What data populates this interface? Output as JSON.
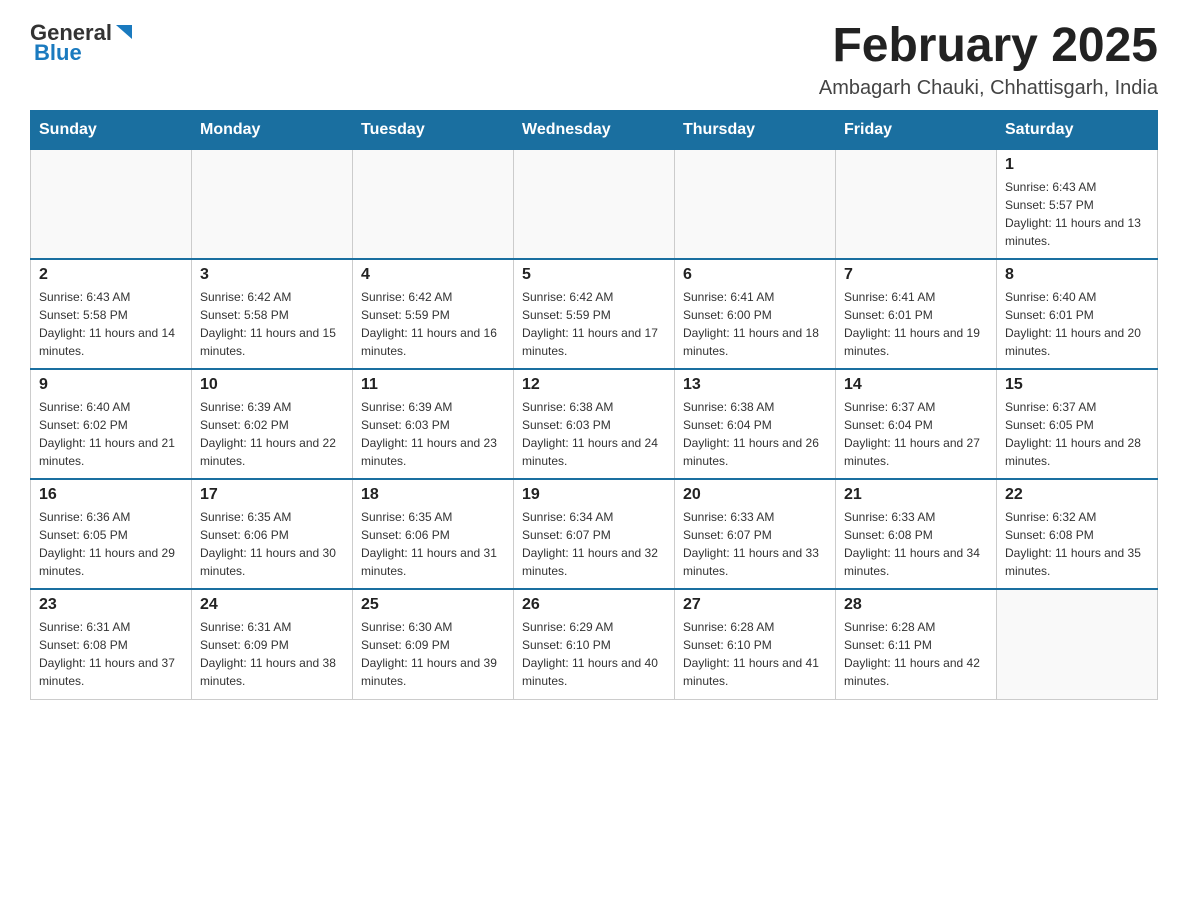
{
  "header": {
    "logo_general": "General",
    "logo_blue": "Blue",
    "month_year": "February 2025",
    "location": "Ambagarh Chauki, Chhattisgarh, India"
  },
  "weekdays": [
    "Sunday",
    "Monday",
    "Tuesday",
    "Wednesday",
    "Thursday",
    "Friday",
    "Saturday"
  ],
  "weeks": [
    [
      {
        "day": "",
        "sunrise": "",
        "sunset": "",
        "daylight": "",
        "empty": true
      },
      {
        "day": "",
        "sunrise": "",
        "sunset": "",
        "daylight": "",
        "empty": true
      },
      {
        "day": "",
        "sunrise": "",
        "sunset": "",
        "daylight": "",
        "empty": true
      },
      {
        "day": "",
        "sunrise": "",
        "sunset": "",
        "daylight": "",
        "empty": true
      },
      {
        "day": "",
        "sunrise": "",
        "sunset": "",
        "daylight": "",
        "empty": true
      },
      {
        "day": "",
        "sunrise": "",
        "sunset": "",
        "daylight": "",
        "empty": true
      },
      {
        "day": "1",
        "sunrise": "Sunrise: 6:43 AM",
        "sunset": "Sunset: 5:57 PM",
        "daylight": "Daylight: 11 hours and 13 minutes.",
        "empty": false
      }
    ],
    [
      {
        "day": "2",
        "sunrise": "Sunrise: 6:43 AM",
        "sunset": "Sunset: 5:58 PM",
        "daylight": "Daylight: 11 hours and 14 minutes.",
        "empty": false
      },
      {
        "day": "3",
        "sunrise": "Sunrise: 6:42 AM",
        "sunset": "Sunset: 5:58 PM",
        "daylight": "Daylight: 11 hours and 15 minutes.",
        "empty": false
      },
      {
        "day": "4",
        "sunrise": "Sunrise: 6:42 AM",
        "sunset": "Sunset: 5:59 PM",
        "daylight": "Daylight: 11 hours and 16 minutes.",
        "empty": false
      },
      {
        "day": "5",
        "sunrise": "Sunrise: 6:42 AM",
        "sunset": "Sunset: 5:59 PM",
        "daylight": "Daylight: 11 hours and 17 minutes.",
        "empty": false
      },
      {
        "day": "6",
        "sunrise": "Sunrise: 6:41 AM",
        "sunset": "Sunset: 6:00 PM",
        "daylight": "Daylight: 11 hours and 18 minutes.",
        "empty": false
      },
      {
        "day": "7",
        "sunrise": "Sunrise: 6:41 AM",
        "sunset": "Sunset: 6:01 PM",
        "daylight": "Daylight: 11 hours and 19 minutes.",
        "empty": false
      },
      {
        "day": "8",
        "sunrise": "Sunrise: 6:40 AM",
        "sunset": "Sunset: 6:01 PM",
        "daylight": "Daylight: 11 hours and 20 minutes.",
        "empty": false
      }
    ],
    [
      {
        "day": "9",
        "sunrise": "Sunrise: 6:40 AM",
        "sunset": "Sunset: 6:02 PM",
        "daylight": "Daylight: 11 hours and 21 minutes.",
        "empty": false
      },
      {
        "day": "10",
        "sunrise": "Sunrise: 6:39 AM",
        "sunset": "Sunset: 6:02 PM",
        "daylight": "Daylight: 11 hours and 22 minutes.",
        "empty": false
      },
      {
        "day": "11",
        "sunrise": "Sunrise: 6:39 AM",
        "sunset": "Sunset: 6:03 PM",
        "daylight": "Daylight: 11 hours and 23 minutes.",
        "empty": false
      },
      {
        "day": "12",
        "sunrise": "Sunrise: 6:38 AM",
        "sunset": "Sunset: 6:03 PM",
        "daylight": "Daylight: 11 hours and 24 minutes.",
        "empty": false
      },
      {
        "day": "13",
        "sunrise": "Sunrise: 6:38 AM",
        "sunset": "Sunset: 6:04 PM",
        "daylight": "Daylight: 11 hours and 26 minutes.",
        "empty": false
      },
      {
        "day": "14",
        "sunrise": "Sunrise: 6:37 AM",
        "sunset": "Sunset: 6:04 PM",
        "daylight": "Daylight: 11 hours and 27 minutes.",
        "empty": false
      },
      {
        "day": "15",
        "sunrise": "Sunrise: 6:37 AM",
        "sunset": "Sunset: 6:05 PM",
        "daylight": "Daylight: 11 hours and 28 minutes.",
        "empty": false
      }
    ],
    [
      {
        "day": "16",
        "sunrise": "Sunrise: 6:36 AM",
        "sunset": "Sunset: 6:05 PM",
        "daylight": "Daylight: 11 hours and 29 minutes.",
        "empty": false
      },
      {
        "day": "17",
        "sunrise": "Sunrise: 6:35 AM",
        "sunset": "Sunset: 6:06 PM",
        "daylight": "Daylight: 11 hours and 30 minutes.",
        "empty": false
      },
      {
        "day": "18",
        "sunrise": "Sunrise: 6:35 AM",
        "sunset": "Sunset: 6:06 PM",
        "daylight": "Daylight: 11 hours and 31 minutes.",
        "empty": false
      },
      {
        "day": "19",
        "sunrise": "Sunrise: 6:34 AM",
        "sunset": "Sunset: 6:07 PM",
        "daylight": "Daylight: 11 hours and 32 minutes.",
        "empty": false
      },
      {
        "day": "20",
        "sunrise": "Sunrise: 6:33 AM",
        "sunset": "Sunset: 6:07 PM",
        "daylight": "Daylight: 11 hours and 33 minutes.",
        "empty": false
      },
      {
        "day": "21",
        "sunrise": "Sunrise: 6:33 AM",
        "sunset": "Sunset: 6:08 PM",
        "daylight": "Daylight: 11 hours and 34 minutes.",
        "empty": false
      },
      {
        "day": "22",
        "sunrise": "Sunrise: 6:32 AM",
        "sunset": "Sunset: 6:08 PM",
        "daylight": "Daylight: 11 hours and 35 minutes.",
        "empty": false
      }
    ],
    [
      {
        "day": "23",
        "sunrise": "Sunrise: 6:31 AM",
        "sunset": "Sunset: 6:08 PM",
        "daylight": "Daylight: 11 hours and 37 minutes.",
        "empty": false
      },
      {
        "day": "24",
        "sunrise": "Sunrise: 6:31 AM",
        "sunset": "Sunset: 6:09 PM",
        "daylight": "Daylight: 11 hours and 38 minutes.",
        "empty": false
      },
      {
        "day": "25",
        "sunrise": "Sunrise: 6:30 AM",
        "sunset": "Sunset: 6:09 PM",
        "daylight": "Daylight: 11 hours and 39 minutes.",
        "empty": false
      },
      {
        "day": "26",
        "sunrise": "Sunrise: 6:29 AM",
        "sunset": "Sunset: 6:10 PM",
        "daylight": "Daylight: 11 hours and 40 minutes.",
        "empty": false
      },
      {
        "day": "27",
        "sunrise": "Sunrise: 6:28 AM",
        "sunset": "Sunset: 6:10 PM",
        "daylight": "Daylight: 11 hours and 41 minutes.",
        "empty": false
      },
      {
        "day": "28",
        "sunrise": "Sunrise: 6:28 AM",
        "sunset": "Sunset: 6:11 PM",
        "daylight": "Daylight: 11 hours and 42 minutes.",
        "empty": false
      },
      {
        "day": "",
        "sunrise": "",
        "sunset": "",
        "daylight": "",
        "empty": true
      }
    ]
  ]
}
